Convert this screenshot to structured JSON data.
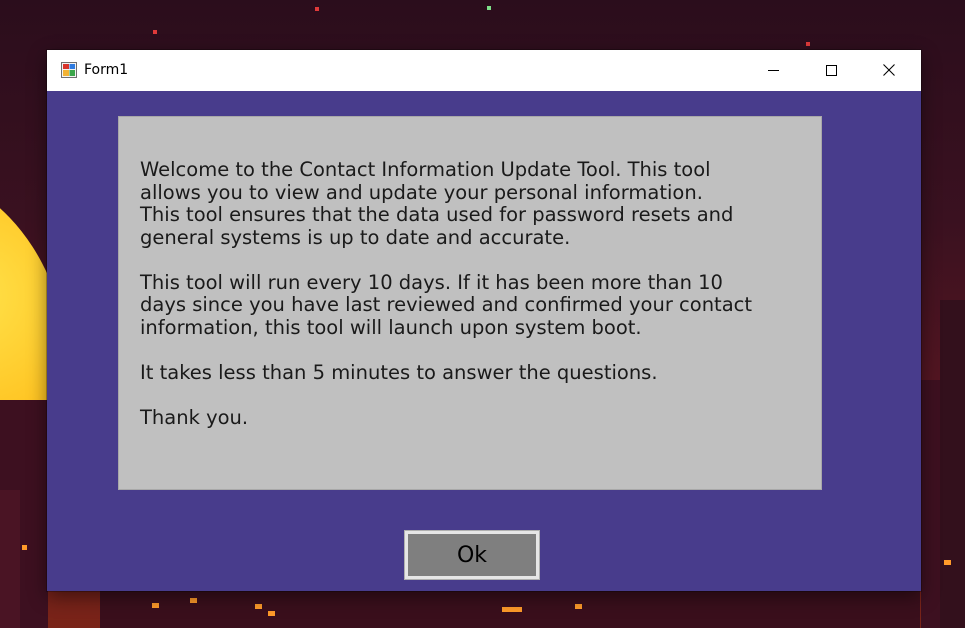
{
  "window": {
    "title": "Form1",
    "controls": {
      "minimize_icon": "minimize-icon",
      "maximize_icon": "maximize-icon",
      "close_icon": "close-icon"
    }
  },
  "message": {
    "paragraphs": [
      "Welcome to the Contact Information Update Tool. This tool\nallows you to view and update your personal information.\nThis tool ensures that the data used for password resets and\ngeneral systems is up to date and accurate.",
      "This tool will run every 10 days. If it has been more than 10\ndays since you have last reviewed and confirmed your contact\ninformation, this tool will launch upon system boot.",
      "It takes less than 5 minutes to answer the questions.",
      "Thank you."
    ]
  },
  "buttons": {
    "ok_label": "Ok"
  },
  "colors": {
    "form_background": "#483c8c",
    "panel_background": "#c0c0c0",
    "button_background": "#7f7f7f"
  }
}
